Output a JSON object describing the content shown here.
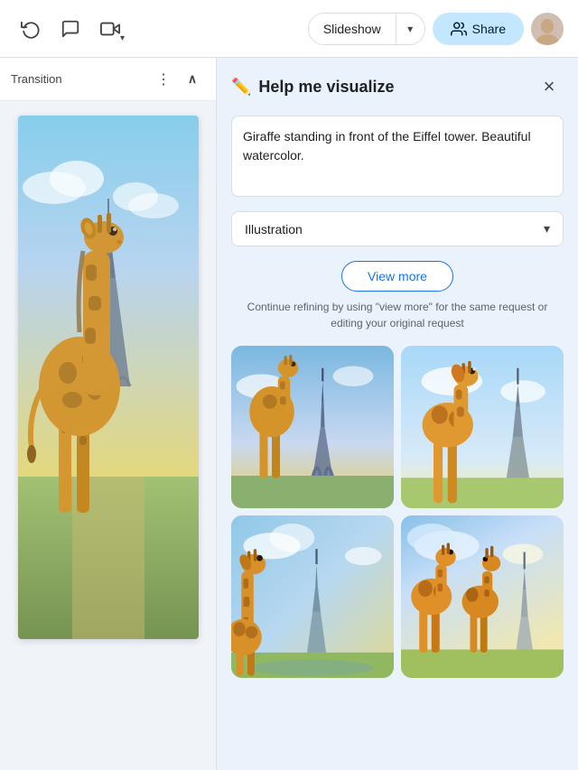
{
  "toolbar": {
    "slideshow_label": "Slideshow",
    "share_label": "Share",
    "history_icon": "↩",
    "comments_icon": "💬",
    "camera_icon": "📷",
    "dropdown_arrow": "▾"
  },
  "slide_panel": {
    "transition_label": "Transition",
    "more_icon": "⋮",
    "chevron_up": "^"
  },
  "help_visualize": {
    "title": "Help me visualize",
    "prompt_text": "Giraffe standing in front of the Eiffel tower. Beautiful watercolor.",
    "style_label": "Illustration",
    "view_more_label": "View more",
    "hint_text": "Continue refining by using \"view more\" for the same request or editing your original request",
    "close_icon": "×",
    "pencil_icon": "✏"
  },
  "colors": {
    "accent_blue": "#1a73e8",
    "share_bg": "#c2e7ff",
    "panel_bg": "#eaf2fb"
  }
}
